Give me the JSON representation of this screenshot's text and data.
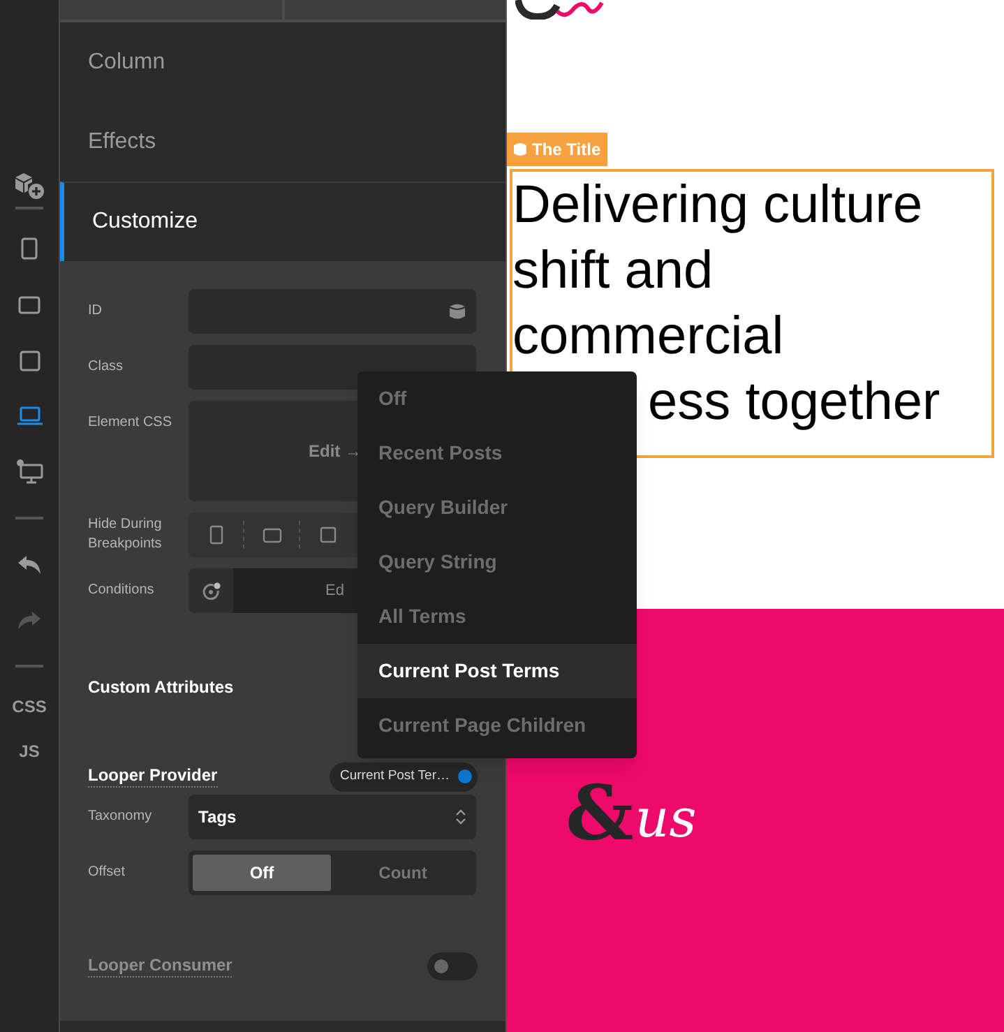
{
  "rail": {
    "items": [
      {
        "kind": "icon",
        "selected": false,
        "disabled": false
      },
      {
        "kind": "divider"
      },
      {
        "kind": "icon",
        "selected": false,
        "disabled": false
      },
      {
        "kind": "icon",
        "selected": false,
        "disabled": false
      },
      {
        "kind": "icon",
        "selected": false,
        "disabled": false
      },
      {
        "kind": "icon",
        "selected": true,
        "disabled": false
      },
      {
        "kind": "icon",
        "selected": false,
        "disabled": false
      },
      {
        "kind": "divider"
      },
      {
        "kind": "icon",
        "selected": false,
        "disabled": false
      },
      {
        "kind": "icon",
        "selected": false,
        "disabled": true
      },
      {
        "kind": "divider"
      },
      {
        "kind": "text",
        "label": "CSS"
      },
      {
        "kind": "text",
        "label": "JS"
      }
    ]
  },
  "panel": {
    "sections": [
      {
        "label": "Column",
        "selected": false
      },
      {
        "label": "Effects",
        "selected": false
      },
      {
        "label": "Customize",
        "selected": true
      }
    ],
    "fields": [
      {
        "kind": "input",
        "label": "ID"
      },
      {
        "kind": "input",
        "label": "Class"
      },
      {
        "kind": "edit",
        "label": "Element CSS",
        "value": "Edit →"
      },
      {
        "kind": "breakpoints",
        "label": "Hide During Breakpoints"
      },
      {
        "kind": "conditions",
        "label": "Conditions",
        "value": "Ed"
      }
    ],
    "custom_attributes": "Custom Attributes",
    "looper_provider": {
      "label": "Looper Provider",
      "value": "Current Post Ter…",
      "on": true
    },
    "provider_fields": [
      {
        "kind": "select",
        "label": "Taxonomy",
        "value": "Tags"
      },
      {
        "kind": "segmented",
        "label": "Offset",
        "options": [
          {
            "label": "Off",
            "selected": true
          },
          {
            "label": "Count",
            "selected": false
          }
        ]
      }
    ],
    "looper_consumer": {
      "label": "Looper Consumer",
      "on": false
    }
  },
  "dropdown": {
    "items": [
      {
        "label": "Off",
        "selected": false
      },
      {
        "label": "Recent Posts",
        "selected": false
      },
      {
        "label": "Query Builder",
        "selected": false
      },
      {
        "label": "Query String",
        "selected": false
      },
      {
        "label": "All Terms",
        "selected": false
      },
      {
        "label": "Current Post Terms",
        "selected": true
      },
      {
        "label": "Current Page Children",
        "selected": false
      }
    ]
  },
  "canvas": {
    "element_label": "The Title",
    "headline_lines": [
      "Delivering culture",
      "shift and",
      "commercial",
      "ess together"
    ],
    "logo": {
      "amp": "&",
      "us": "us"
    }
  }
}
